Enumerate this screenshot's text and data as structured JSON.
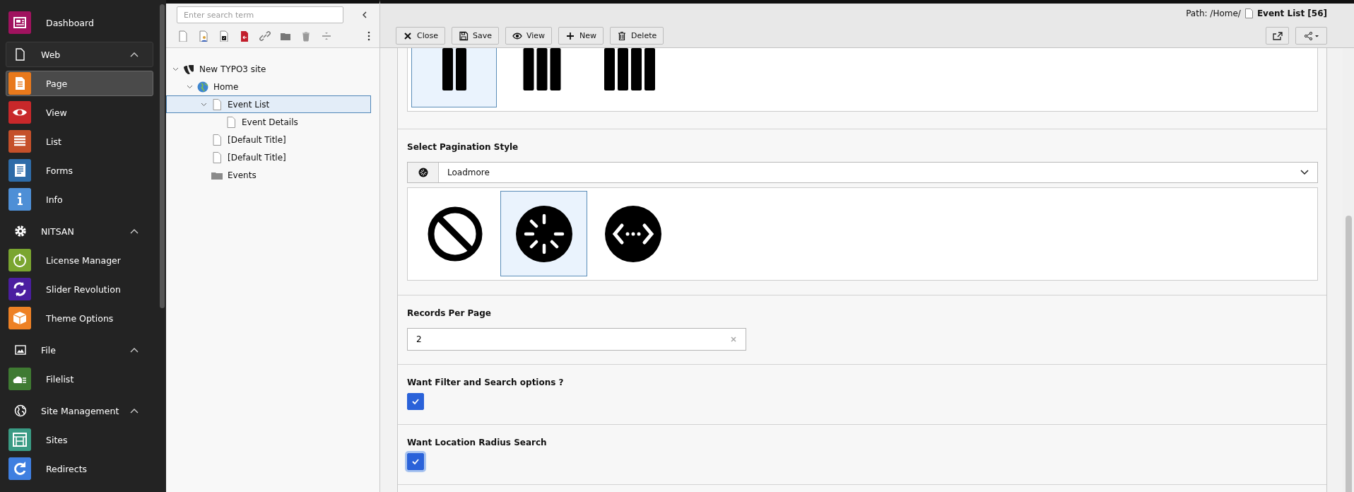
{
  "sidebar": {
    "items": [
      {
        "kind": "module",
        "label": "Dashboard",
        "color": "#a0135f",
        "selected": false
      },
      {
        "kind": "group",
        "label": "Web",
        "expanded": true,
        "active": true,
        "children": [
          {
            "kind": "module",
            "label": "Page",
            "color": "#e8791c",
            "selected": true
          },
          {
            "kind": "module",
            "label": "View",
            "color": "#c8282a",
            "selected": false
          },
          {
            "kind": "module",
            "label": "List",
            "color": "#c5502a",
            "selected": false
          },
          {
            "kind": "module",
            "label": "Forms",
            "color": "#2e6ca8",
            "selected": false
          },
          {
            "kind": "module",
            "label": "Info",
            "color": "#4e8fd6",
            "selected": false
          }
        ]
      },
      {
        "kind": "group",
        "label": "NITSAN",
        "expanded": true,
        "active": false,
        "children": [
          {
            "kind": "module",
            "label": "License Manager",
            "color": "#7aa530",
            "selected": false
          },
          {
            "kind": "module",
            "label": "Slider Revolution",
            "color": "#4b1ea0",
            "selected": false
          },
          {
            "kind": "module",
            "label": "Theme Options",
            "color": "#ee8125",
            "selected": false
          }
        ]
      },
      {
        "kind": "group",
        "label": "File",
        "expanded": true,
        "active": false,
        "children": [
          {
            "kind": "module",
            "label": "Filelist",
            "color": "#3f7a32",
            "selected": false
          }
        ]
      },
      {
        "kind": "group",
        "label": "Site Management",
        "expanded": true,
        "active": false,
        "children": [
          {
            "kind": "module",
            "label": "Sites",
            "color": "#3a9b84",
            "selected": false
          },
          {
            "kind": "module",
            "label": "Redirects",
            "color": "#3f7fe0",
            "selected": false
          }
        ]
      }
    ]
  },
  "page_tree": {
    "search": {
      "placeholder": "Enter search term"
    },
    "nodes": [
      {
        "kind": "site",
        "label": "New TYPO3 site",
        "expanded": true,
        "selected": false,
        "children": [
          {
            "kind": "home",
            "label": "Home",
            "expanded": true,
            "selected": false,
            "children": [
              {
                "kind": "page",
                "label": "Event List",
                "expanded": true,
                "selected": true,
                "children": [
                  {
                    "kind": "page",
                    "label": "Event Details",
                    "selected": false
                  }
                ]
              },
              {
                "kind": "page",
                "label": "[Default Title]",
                "selected": false
              },
              {
                "kind": "page",
                "label": "[Default Title]",
                "selected": false
              },
              {
                "kind": "folder",
                "label": "Events",
                "selected": false
              }
            ]
          }
        ]
      }
    ]
  },
  "docheader": {
    "path_label": "Path: /Home/",
    "page_title": "Event List [56]",
    "buttons": [
      "Close",
      "Save",
      "View",
      "New",
      "Delete"
    ]
  },
  "form": {
    "fields": [
      {
        "kind": "image_picker",
        "options": [
          {
            "selected": true
          },
          {
            "selected": false
          },
          {
            "selected": false
          }
        ]
      },
      {
        "kind": "select",
        "label": "Select Pagination Style",
        "value": "Loadmore",
        "options": [
          {
            "selected": false
          },
          {
            "selected": true
          },
          {
            "selected": false
          }
        ]
      },
      {
        "kind": "text",
        "label": "Records Per Page",
        "value": "2"
      },
      {
        "kind": "checkbox",
        "label": "Want Filter and Search options ?",
        "checked": true,
        "focused": false
      },
      {
        "kind": "checkbox",
        "label": "Want Location Radius Search",
        "checked": true,
        "focused": true
      }
    ]
  }
}
